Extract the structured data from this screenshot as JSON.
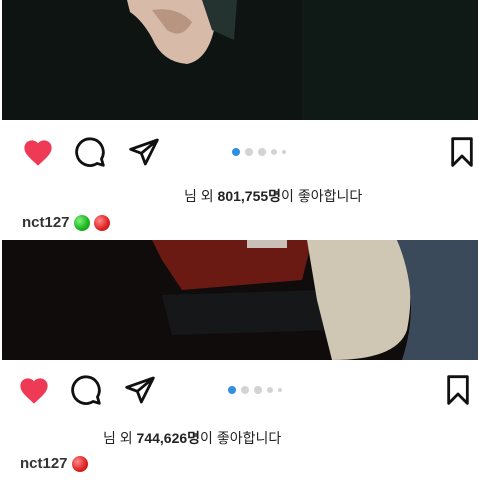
{
  "posts": [
    {
      "likes_prefix": "님 외 ",
      "likes_count": "801,755명",
      "likes_suffix": "이 좋아합니다",
      "username": "nct127",
      "emojis": [
        "green-circle",
        "red-circle"
      ]
    },
    {
      "likes_prefix": "님 외 ",
      "likes_count": "744,626명",
      "likes_suffix": "이 좋아합니다",
      "username": "nct127",
      "emojis": [
        "red-circle"
      ]
    }
  ],
  "icons": {
    "like": "heart-icon",
    "comment": "comment-icon",
    "share": "send-icon",
    "save": "bookmark-icon"
  },
  "colors": {
    "like_active": "#ee3a55",
    "carousel_active": "#2f8fe0",
    "carousel_inactive": "#d3d3d3"
  }
}
